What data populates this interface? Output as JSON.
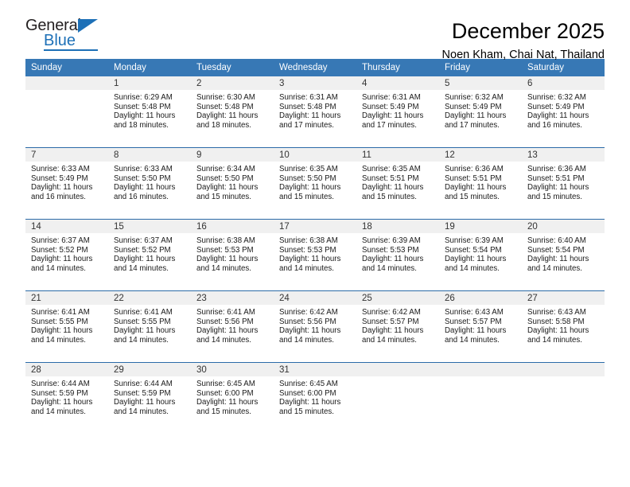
{
  "brand": {
    "name_top": "General",
    "name_bottom": "Blue",
    "accent_color": "#1d70b7",
    "triangle_icon": "triangle-icon"
  },
  "header": {
    "title": "December 2025",
    "location": "Noen Kham, Chai Nat, Thailand"
  },
  "theme": {
    "header_bg": "#3778b5",
    "daynum_bg": "#f0f0f0",
    "row_divider": "#2b6ba8"
  },
  "calendar": {
    "weekday_headers": [
      "Sunday",
      "Monday",
      "Tuesday",
      "Wednesday",
      "Thursday",
      "Friday",
      "Saturday"
    ],
    "weeks": [
      [
        {
          "day": "",
          "lines": []
        },
        {
          "day": "1",
          "lines": [
            "Sunrise: 6:29 AM",
            "Sunset: 5:48 PM",
            "Daylight: 11 hours",
            "and 18 minutes."
          ]
        },
        {
          "day": "2",
          "lines": [
            "Sunrise: 6:30 AM",
            "Sunset: 5:48 PM",
            "Daylight: 11 hours",
            "and 18 minutes."
          ]
        },
        {
          "day": "3",
          "lines": [
            "Sunrise: 6:31 AM",
            "Sunset: 5:48 PM",
            "Daylight: 11 hours",
            "and 17 minutes."
          ]
        },
        {
          "day": "4",
          "lines": [
            "Sunrise: 6:31 AM",
            "Sunset: 5:49 PM",
            "Daylight: 11 hours",
            "and 17 minutes."
          ]
        },
        {
          "day": "5",
          "lines": [
            "Sunrise: 6:32 AM",
            "Sunset: 5:49 PM",
            "Daylight: 11 hours",
            "and 17 minutes."
          ]
        },
        {
          "day": "6",
          "lines": [
            "Sunrise: 6:32 AM",
            "Sunset: 5:49 PM",
            "Daylight: 11 hours",
            "and 16 minutes."
          ]
        }
      ],
      [
        {
          "day": "7",
          "lines": [
            "Sunrise: 6:33 AM",
            "Sunset: 5:49 PM",
            "Daylight: 11 hours",
            "and 16 minutes."
          ]
        },
        {
          "day": "8",
          "lines": [
            "Sunrise: 6:33 AM",
            "Sunset: 5:50 PM",
            "Daylight: 11 hours",
            "and 16 minutes."
          ]
        },
        {
          "day": "9",
          "lines": [
            "Sunrise: 6:34 AM",
            "Sunset: 5:50 PM",
            "Daylight: 11 hours",
            "and 15 minutes."
          ]
        },
        {
          "day": "10",
          "lines": [
            "Sunrise: 6:35 AM",
            "Sunset: 5:50 PM",
            "Daylight: 11 hours",
            "and 15 minutes."
          ]
        },
        {
          "day": "11",
          "lines": [
            "Sunrise: 6:35 AM",
            "Sunset: 5:51 PM",
            "Daylight: 11 hours",
            "and 15 minutes."
          ]
        },
        {
          "day": "12",
          "lines": [
            "Sunrise: 6:36 AM",
            "Sunset: 5:51 PM",
            "Daylight: 11 hours",
            "and 15 minutes."
          ]
        },
        {
          "day": "13",
          "lines": [
            "Sunrise: 6:36 AM",
            "Sunset: 5:51 PM",
            "Daylight: 11 hours",
            "and 15 minutes."
          ]
        }
      ],
      [
        {
          "day": "14",
          "lines": [
            "Sunrise: 6:37 AM",
            "Sunset: 5:52 PM",
            "Daylight: 11 hours",
            "and 14 minutes."
          ]
        },
        {
          "day": "15",
          "lines": [
            "Sunrise: 6:37 AM",
            "Sunset: 5:52 PM",
            "Daylight: 11 hours",
            "and 14 minutes."
          ]
        },
        {
          "day": "16",
          "lines": [
            "Sunrise: 6:38 AM",
            "Sunset: 5:53 PM",
            "Daylight: 11 hours",
            "and 14 minutes."
          ]
        },
        {
          "day": "17",
          "lines": [
            "Sunrise: 6:38 AM",
            "Sunset: 5:53 PM",
            "Daylight: 11 hours",
            "and 14 minutes."
          ]
        },
        {
          "day": "18",
          "lines": [
            "Sunrise: 6:39 AM",
            "Sunset: 5:53 PM",
            "Daylight: 11 hours",
            "and 14 minutes."
          ]
        },
        {
          "day": "19",
          "lines": [
            "Sunrise: 6:39 AM",
            "Sunset: 5:54 PM",
            "Daylight: 11 hours",
            "and 14 minutes."
          ]
        },
        {
          "day": "20",
          "lines": [
            "Sunrise: 6:40 AM",
            "Sunset: 5:54 PM",
            "Daylight: 11 hours",
            "and 14 minutes."
          ]
        }
      ],
      [
        {
          "day": "21",
          "lines": [
            "Sunrise: 6:41 AM",
            "Sunset: 5:55 PM",
            "Daylight: 11 hours",
            "and 14 minutes."
          ]
        },
        {
          "day": "22",
          "lines": [
            "Sunrise: 6:41 AM",
            "Sunset: 5:55 PM",
            "Daylight: 11 hours",
            "and 14 minutes."
          ]
        },
        {
          "day": "23",
          "lines": [
            "Sunrise: 6:41 AM",
            "Sunset: 5:56 PM",
            "Daylight: 11 hours",
            "and 14 minutes."
          ]
        },
        {
          "day": "24",
          "lines": [
            "Sunrise: 6:42 AM",
            "Sunset: 5:56 PM",
            "Daylight: 11 hours",
            "and 14 minutes."
          ]
        },
        {
          "day": "25",
          "lines": [
            "Sunrise: 6:42 AM",
            "Sunset: 5:57 PM",
            "Daylight: 11 hours",
            "and 14 minutes."
          ]
        },
        {
          "day": "26",
          "lines": [
            "Sunrise: 6:43 AM",
            "Sunset: 5:57 PM",
            "Daylight: 11 hours",
            "and 14 minutes."
          ]
        },
        {
          "day": "27",
          "lines": [
            "Sunrise: 6:43 AM",
            "Sunset: 5:58 PM",
            "Daylight: 11 hours",
            "and 14 minutes."
          ]
        }
      ],
      [
        {
          "day": "28",
          "lines": [
            "Sunrise: 6:44 AM",
            "Sunset: 5:59 PM",
            "Daylight: 11 hours",
            "and 14 minutes."
          ]
        },
        {
          "day": "29",
          "lines": [
            "Sunrise: 6:44 AM",
            "Sunset: 5:59 PM",
            "Daylight: 11 hours",
            "and 14 minutes."
          ]
        },
        {
          "day": "30",
          "lines": [
            "Sunrise: 6:45 AM",
            "Sunset: 6:00 PM",
            "Daylight: 11 hours",
            "and 15 minutes."
          ]
        },
        {
          "day": "31",
          "lines": [
            "Sunrise: 6:45 AM",
            "Sunset: 6:00 PM",
            "Daylight: 11 hours",
            "and 15 minutes."
          ]
        },
        {
          "day": "",
          "lines": []
        },
        {
          "day": "",
          "lines": []
        },
        {
          "day": "",
          "lines": []
        }
      ]
    ]
  }
}
